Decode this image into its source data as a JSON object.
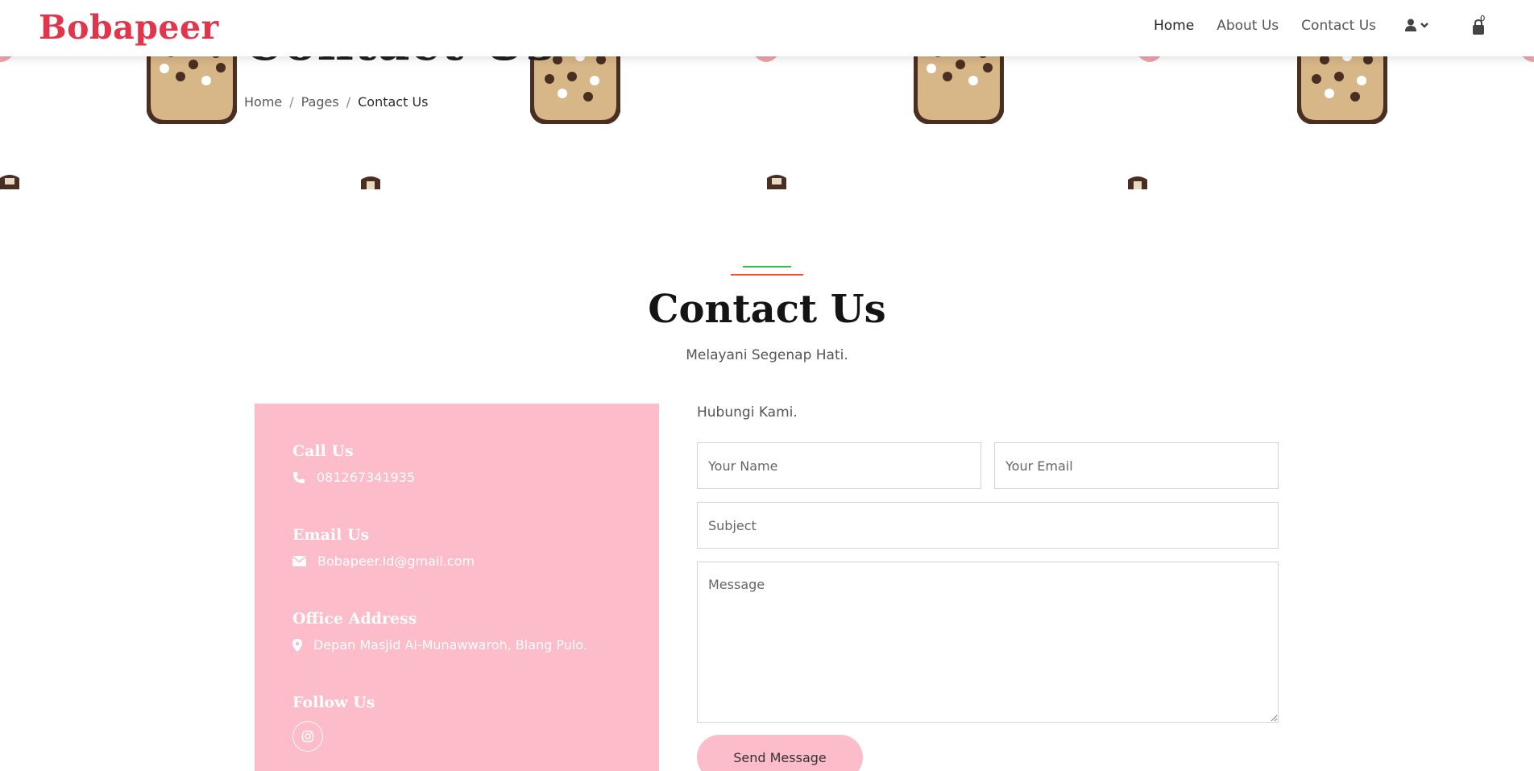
{
  "navbar": {
    "brand": "Bobapeer",
    "links": [
      "Home",
      "About Us",
      "Contact Us"
    ],
    "active_link": "Home",
    "user_icon": "user-icon",
    "cart_icon": "shopping-bag-icon",
    "cart_count": "0"
  },
  "hero": {
    "title": "Contact Us",
    "breadcrumb": [
      "Home",
      "Pages",
      "Contact Us"
    ],
    "separator": "/"
  },
  "section": {
    "title": "Contact Us",
    "subtitle": "Melayani Segenap Hati."
  },
  "info": {
    "call": {
      "title": "Call Us",
      "value": "081267341935",
      "icon": "phone-icon"
    },
    "email": {
      "title": "Email Us",
      "value": "Bobapeer.id@gmail.com",
      "icon": "envelope-icon"
    },
    "address": {
      "title": "Office Address",
      "value": "Depan Masjid Al-Munawwaroh, Blang Pulo.",
      "icon": "map-marker-icon"
    },
    "follow": {
      "title": "Follow Us",
      "icon": "instagram-icon"
    }
  },
  "form": {
    "intro": "Hubungi Kami.",
    "name_placeholder": "Your Name",
    "email_placeholder": "Your Email",
    "subject_placeholder": "Subject",
    "message_placeholder": "Message",
    "submit_label": "Send Message"
  },
  "colors": {
    "brand": "#e2344a",
    "panel_pink": "#fdbcc9",
    "accent_green": "#3ab54a",
    "accent_orange": "#f0522d"
  }
}
